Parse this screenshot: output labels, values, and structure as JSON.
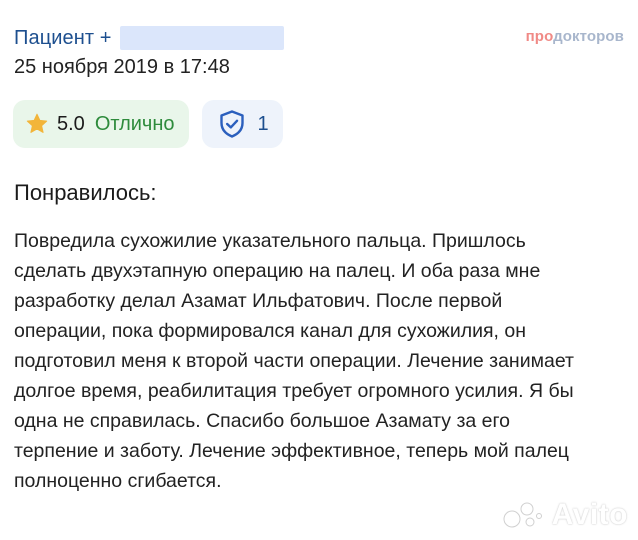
{
  "header": {
    "patient_label": "Пациент +",
    "brand_part_a": "про",
    "brand_part_b": "докторов",
    "date": "25 ноября 2019 в 17:48"
  },
  "rating": {
    "value": "5.0",
    "label": "Отлично",
    "icon": "star-icon"
  },
  "verified": {
    "count": "1",
    "icon": "shield-check-icon"
  },
  "review": {
    "section_title": "Понравилось:",
    "text": "Повредила сухожилие указательного пальца. Пришлось сделать двухэтапную операцию на палец. И оба раза мне разработку делал Азамат Ильфатович. После первой операции, пока формировался канал для сухожилия, он подготовил меня к второй части операции. Лечение занимает долгое время, реабилитация требует огромного усилия. Я бы одна не справилась. Спасибо большое Азамату за его терпение и заботу. Лечение эффективное, теперь мой палец полноценно сгибается."
  },
  "watermark": {
    "text": "Avito"
  },
  "colors": {
    "patient_link": "#1d4f8f",
    "rating_bg": "#e9f6ea",
    "rating_label": "#2e8b3c",
    "star": "#f2b53a",
    "verified_bg": "#eef3fb",
    "shield": "#2b5fbd",
    "brand_a": "#f08a86",
    "brand_b": "#a8b6cc"
  }
}
